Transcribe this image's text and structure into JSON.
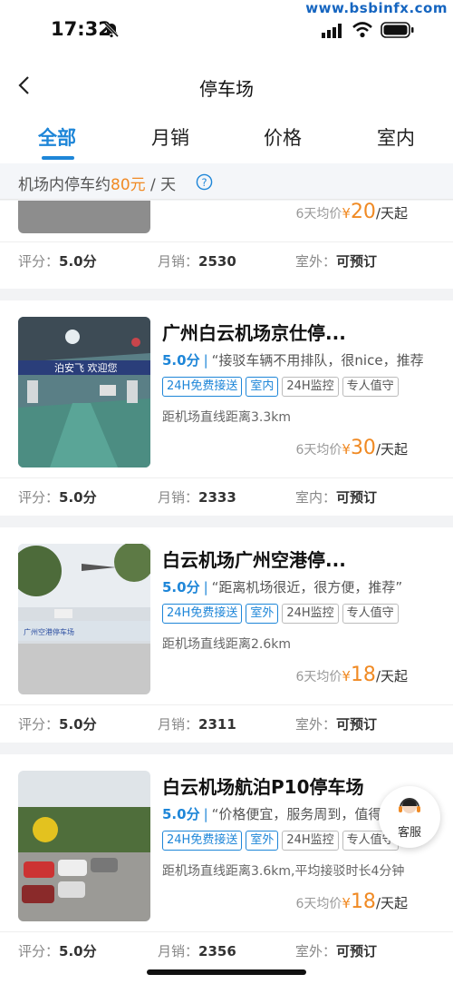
{
  "status": {
    "time": "17:32",
    "watermark": "www.bsbinfx.com"
  },
  "header": {
    "title": "停车场"
  },
  "tabs": [
    {
      "label": "全部",
      "active": true
    },
    {
      "label": "月销",
      "active": false
    },
    {
      "label": "价格",
      "active": false
    },
    {
      "label": "室内",
      "active": false
    }
  ],
  "notice": {
    "prefix": "机场内停车约",
    "price": "80元",
    "suffix": " / 天"
  },
  "cards": [
    {
      "title": "",
      "price_prefix": "6天均价",
      "yen": "¥",
      "price": "20",
      "price_unit": "/天起",
      "stat_rating_label": "评分：",
      "stat_rating": "5.0分",
      "stat_sales_label": "月销：",
      "stat_sales": "2530",
      "stat_type_label": "室外：",
      "stat_type": "可预订"
    },
    {
      "title": "广州白云机场京仕停...",
      "score": "5.0分",
      "review": "“接驳车辆不用排队，很nice，推荐”",
      "tags": [
        "24H免费接送",
        "室内",
        "24H监控",
        "专人值守"
      ],
      "distance": "距机场直线距离3.3km",
      "price_prefix": "6天均价",
      "yen": "¥",
      "price": "30",
      "price_unit": "/天起",
      "stat_rating_label": "评分：",
      "stat_rating": "5.0分",
      "stat_sales_label": "月销：",
      "stat_sales": "2333",
      "stat_type_label": "室内：",
      "stat_type": "可预订"
    },
    {
      "title": "白云机场广州空港停...",
      "score": "5.0分",
      "review": "“距离机场很近，很方便，推荐”",
      "tags": [
        "24H免费接送",
        "室外",
        "24H监控",
        "专人值守"
      ],
      "distance": "距机场直线距离2.6km",
      "price_prefix": "6天均价",
      "yen": "¥",
      "price": "18",
      "price_unit": "/天起",
      "stat_rating_label": "评分：",
      "stat_rating": "5.0分",
      "stat_sales_label": "月销：",
      "stat_sales": "2311",
      "stat_type_label": "室外：",
      "stat_type": "可预订"
    },
    {
      "title": "白云机场航泊P10停车场",
      "score": "5.0分",
      "review": "“价格便宜，服务周到，值得推荐”",
      "tags": [
        "24H免费接送",
        "室外",
        "24H监控",
        "专人值守"
      ],
      "distance": "距机场直线距离3.6km,平均接驳时长4分钟",
      "price_prefix": "6天均价",
      "yen": "¥",
      "price": "18",
      "price_unit": "/天起",
      "stat_rating_label": "评分：",
      "stat_rating": "5.0分",
      "stat_sales_label": "月销：",
      "stat_sales": "2356",
      "stat_type_label": "室外：",
      "stat_type": "可预订"
    }
  ],
  "image_text": {
    "banner1": "泊安飞 欢迎您",
    "banner2": "广州空港停车场"
  },
  "service": {
    "label": "客服"
  },
  "colors": {
    "accent": "#1e86d8",
    "price": "#f08a24"
  }
}
